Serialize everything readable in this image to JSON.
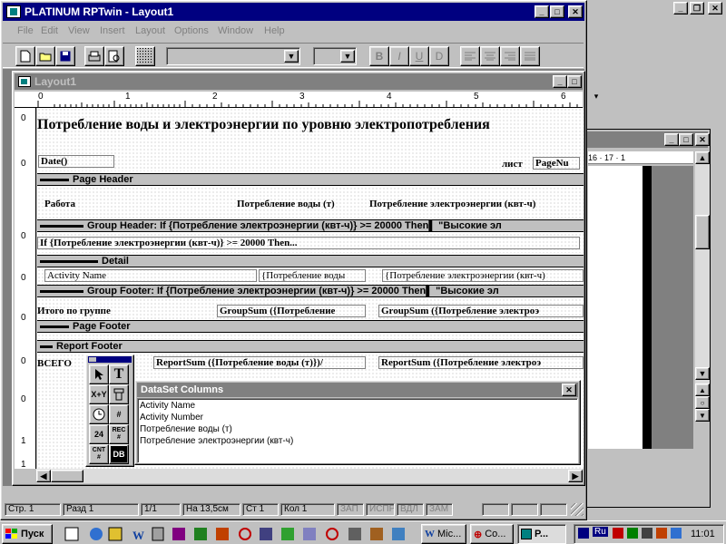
{
  "app": {
    "title": "PLATINUM RPTwin - Layout1",
    "menu": [
      "File",
      "Edit",
      "View",
      "Insert",
      "Layout",
      "Options",
      "Window",
      "Help"
    ]
  },
  "toolbar": {
    "buttons": [
      "new-doc-icon",
      "open-folder-icon",
      "save-disk-icon",
      "print-icon",
      "print-preview-icon",
      "grid-icon"
    ],
    "format_buttons": [
      "B",
      "I",
      "U",
      "D"
    ],
    "align_icons": [
      "align-left-icon",
      "align-center-icon",
      "align-right-icon",
      "justify-icon"
    ]
  },
  "layout_window": {
    "title": "Layout1",
    "ruler_labels": [
      "0",
      "1",
      "2",
      "3",
      "4",
      "5",
      "6"
    ],
    "title_text": "Потребление воды и электроэнергии по уровню электропотребления",
    "date_field": "Date()",
    "list_label": "лист",
    "pagenum_field": "PageNu",
    "bands": {
      "page_header": "Page Header",
      "group_header": "Group Header: If {Потребление электроэнергии (квт-ч)} >= 20000      Then▌       \"Высокие эл",
      "detail": "Detail",
      "group_footer": "Group Footer: If {Потребление электроэнергии (квт-ч)} >= 20000      Then▌       \"Высокие эл",
      "page_footer": "Page Footer",
      "report_footer": "Report Footer"
    },
    "columns": {
      "work": "Работа",
      "water": "Потребление воды (т)",
      "energy": "Потребление электроэнергии (квт-ч)"
    },
    "group_header_field": "If {Потребление электроэнергии (квт-ч)} >= 20000     Then...",
    "detail_fields": [
      "Activity Name",
      "{Потребление воды",
      "{Потребление электроэнергии (квт-ч)"
    ],
    "group_total_label": "Итого по группе",
    "group_sum_fields": [
      "GroupSum ({Потребление",
      "GroupSum ({Потребление электроэ"
    ],
    "total_label": "ВСЕГО",
    "report_sum_fields": [
      "ReportSum ({Потребление воды (т)})/",
      "ReportSum ({Потребление электроэ"
    ]
  },
  "left_ruler": [
    "0",
    "0",
    "0",
    "0",
    "0",
    "0",
    "0",
    "1",
    "1"
  ],
  "right_window": {
    "ruler_text": "16 · 17 · 1"
  },
  "toolbox": {
    "tools": [
      {
        "icon": "arrow-pointer-icon",
        "label": ""
      },
      {
        "icon": "text-tool-icon",
        "label": "T"
      },
      {
        "icon": "formula-tool-icon",
        "label": "X+Y"
      },
      {
        "icon": "database-field-icon",
        "label": ""
      },
      {
        "icon": "clock-icon",
        "label": ""
      },
      {
        "icon": "page-number-icon",
        "label": "#"
      },
      {
        "icon": "calendar-icon",
        "label": "24"
      },
      {
        "icon": "record-count-icon",
        "label": "REC #"
      },
      {
        "icon": "count-icon",
        "label": "CNT #"
      },
      {
        "icon": "db-icon",
        "label": "DB"
      }
    ]
  },
  "dataset": {
    "title": "DataSet Columns",
    "columns": [
      "Activity Name",
      "Activity Number",
      "Потребление воды (т)",
      "Потребление электроэнергии (квт-ч)"
    ]
  },
  "status_bar": {
    "cells": [
      "Стр. 1",
      "Разд 1",
      "1/1",
      "На 13,5см",
      "Ст 1",
      "Кол 1",
      "ЗАП",
      "ИСПР",
      "ВДЛ",
      "ЗАМ"
    ]
  },
  "taskbar": {
    "start": "Пуск",
    "tasks": [
      "Mic...",
      "Co...",
      "P..."
    ],
    "lang": "Ru",
    "clock": "11:01"
  }
}
